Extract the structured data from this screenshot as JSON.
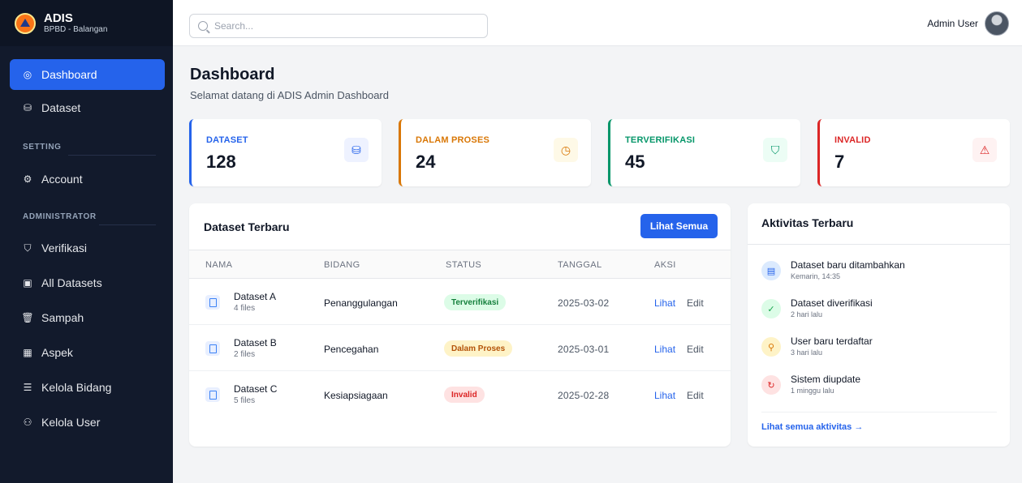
{
  "brand": {
    "title": "ADIS",
    "subtitle": "BPBD - Balangan"
  },
  "sidebar": {
    "items": [
      {
        "label": "Dashboard",
        "icon": "gauge-icon",
        "active": true
      },
      {
        "label": "Dataset",
        "icon": "database-icon"
      },
      {
        "label": "Account",
        "icon": "gear-icon"
      },
      {
        "label": "Verifikasi",
        "icon": "shield-icon"
      },
      {
        "label": "All Datasets",
        "icon": "clipboard-icon"
      },
      {
        "label": "Sampah",
        "icon": "trash-icon"
      },
      {
        "label": "Aspek",
        "icon": "grid-icon"
      },
      {
        "label": "Kelola Bidang",
        "icon": "sliders-icon"
      },
      {
        "label": "Kelola User",
        "icon": "users-icon"
      }
    ],
    "sections": {
      "setting": "SETTING",
      "administrator": "ADMINISTRATOR"
    }
  },
  "topbar": {
    "search_placeholder": "Search...",
    "user_name": "Admin User"
  },
  "page": {
    "title": "Dashboard",
    "subtitle": "Selamat datang di ADIS Admin Dashboard"
  },
  "stats": [
    {
      "label": "DATASET",
      "value": "128",
      "color": "#2563eb",
      "icon_bg": "#eef2ff",
      "icon": "database-icon"
    },
    {
      "label": "DALAM PROSES",
      "value": "24",
      "color": "#d97706",
      "icon_bg": "#fef9e7",
      "icon": "clock-icon"
    },
    {
      "label": "TERVERIFIKASI",
      "value": "45",
      "color": "#059669",
      "icon_bg": "#ecfdf5",
      "icon": "shield-icon"
    },
    {
      "label": "INVALID",
      "value": "7",
      "color": "#dc2626",
      "icon_bg": "#fef2f2",
      "icon": "alert-triangle-icon"
    }
  ],
  "recent_datasets": {
    "title": "Dataset Terbaru",
    "button": "Lihat Semua",
    "columns": [
      "NAMA",
      "BIDANG",
      "STATUS",
      "TANGGAL",
      "AKSI"
    ],
    "rows": [
      {
        "name": "Dataset A",
        "files": "4 files",
        "bidang": "Penanggulangan",
        "status": "Terverifikasi",
        "status_bg": "#dcfce7",
        "status_color": "#15803d",
        "date": "2025-03-02",
        "view": "Lihat",
        "edit": "Edit"
      },
      {
        "name": "Dataset B",
        "files": "2 files",
        "bidang": "Pencegahan",
        "status": "Dalam Proses",
        "status_bg": "#fef3c7",
        "status_color": "#b45309",
        "date": "2025-03-01",
        "view": "Lihat",
        "edit": "Edit"
      },
      {
        "name": "Dataset C",
        "files": "5 files",
        "bidang": "Kesiapsiagaan",
        "status": "Invalid",
        "status_bg": "#fee2e2",
        "status_color": "#dc2626",
        "date": "2025-02-28",
        "view": "Lihat",
        "edit": "Edit"
      }
    ]
  },
  "activities": {
    "title": "Aktivitas Terbaru",
    "items": [
      {
        "title": "Dataset baru ditambahkan",
        "time": "Kemarin, 14:35",
        "icon": "file-icon",
        "bg": "#dbeafe",
        "color": "#2563eb"
      },
      {
        "title": "Dataset diverifikasi",
        "time": "2 hari lalu",
        "icon": "check-icon",
        "bg": "#dcfce7",
        "color": "#16a34a"
      },
      {
        "title": "User baru terdaftar",
        "time": "3 hari lalu",
        "icon": "user-plus-icon",
        "bg": "#fef3c7",
        "color": "#d97706"
      },
      {
        "title": "Sistem diupdate",
        "time": "1 minggu lalu",
        "icon": "refresh-icon",
        "bg": "#fee2e2",
        "color": "#dc2626"
      }
    ],
    "link": "Lihat semua aktivitas →"
  }
}
